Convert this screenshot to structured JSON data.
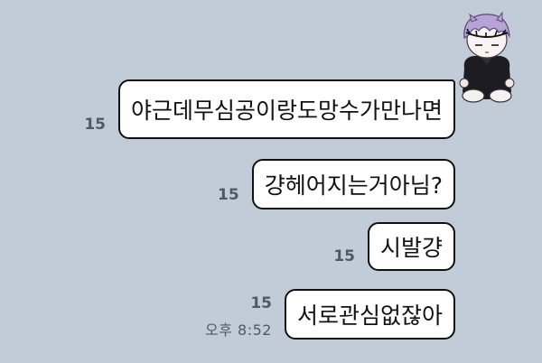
{
  "messages": [
    {
      "text": "야근데무심공이랑도망수가만나면",
      "unread": "15",
      "time": ""
    },
    {
      "text": "걍헤어지는거아님?",
      "unread": "15",
      "time": ""
    },
    {
      "text": "시발걍",
      "unread": "15",
      "time": ""
    },
    {
      "text": "서로관심없잖아",
      "unread": "15",
      "time": "오후 8:52"
    }
  ],
  "colors": {
    "background": "#c2cbd8",
    "bubble": "#ffffff",
    "text": "#111111",
    "meta": "#505a66"
  }
}
